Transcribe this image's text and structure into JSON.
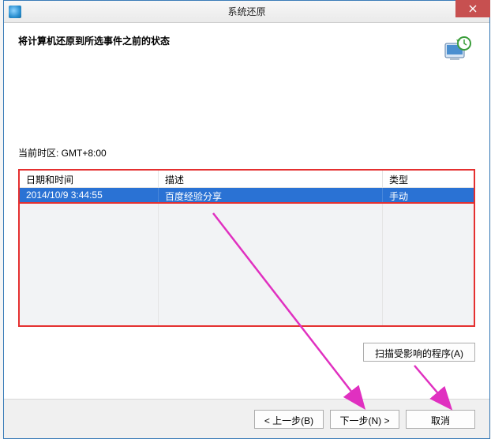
{
  "window_title": "系统还原",
  "header_text": "将计算机还原到所选事件之前的状态",
  "timezone_label": "当前时区: GMT+8:00",
  "table": {
    "headers": {
      "date": "日期和时间",
      "desc": "描述",
      "type": "类型"
    },
    "rows": [
      {
        "date": "2014/10/9 3:44:55",
        "desc": "百度经验分享",
        "type": "手动"
      }
    ]
  },
  "buttons": {
    "scan": "扫描受影响的程序(A)",
    "back": "< 上一步(B)",
    "next": "下一步(N) >",
    "cancel": "取消"
  }
}
